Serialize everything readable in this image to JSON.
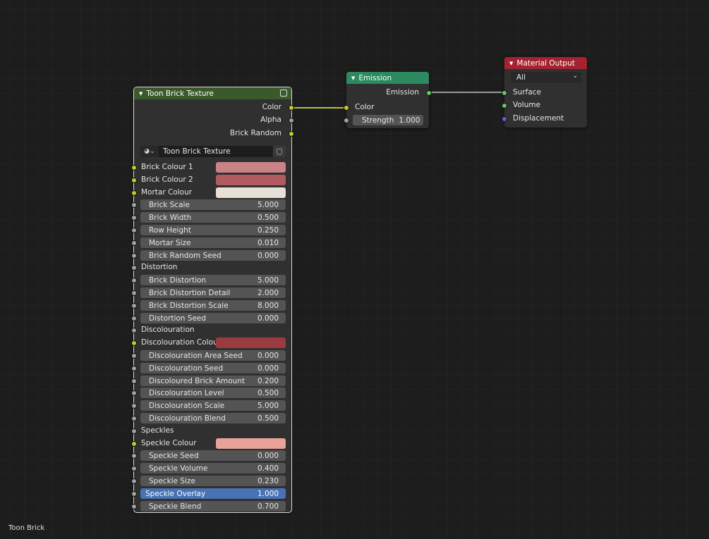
{
  "editor": {
    "material_name": "Toon Brick"
  },
  "colors": {
    "group_header": "#3b5a2c",
    "emission_header": "#2b8a5f",
    "output_header": "#a52330",
    "brick1": "#c98387",
    "brick2": "#b15b61",
    "mortar": "#e8e0d6",
    "discolouration": "#9b3b3f",
    "speckle": "#e8a29a"
  },
  "group_node": {
    "title": "Toon Brick Texture",
    "outputs": [
      "Color",
      "Alpha",
      "Brick Random"
    ],
    "datablock": "Toon Brick Texture",
    "inputs": [
      {
        "label": "Brick Colour 1",
        "type": "color",
        "color": "#c98387"
      },
      {
        "label": "Brick Colour 2",
        "type": "color",
        "color": "#b15b61"
      },
      {
        "label": "Mortar Colour",
        "type": "color",
        "color": "#e8e0d6"
      },
      {
        "label": "Brick Scale",
        "type": "value",
        "value": "5.000"
      },
      {
        "label": "Brick Width",
        "type": "value",
        "value": "0.500"
      },
      {
        "label": "Row Height",
        "type": "value",
        "value": "0.250"
      },
      {
        "label": "Mortar Size",
        "type": "value",
        "value": "0.010"
      },
      {
        "label": "Brick Random Seed",
        "type": "value",
        "value": "0.000"
      },
      {
        "label": "Distortion",
        "type": "label"
      },
      {
        "label": "Brick Distortion",
        "type": "value",
        "value": "5.000"
      },
      {
        "label": "Brick Distortion Detail",
        "type": "value",
        "value": "2.000"
      },
      {
        "label": "Brick Distortion Scale",
        "type": "value",
        "value": "8.000"
      },
      {
        "label": "Distortion Seed",
        "type": "value",
        "value": "0.000"
      },
      {
        "label": "Discolouration",
        "type": "label"
      },
      {
        "label": "Discolouration Colour",
        "type": "color",
        "color": "#9b3b3f"
      },
      {
        "label": "Discolouration Area Seed",
        "type": "value",
        "value": "0.000"
      },
      {
        "label": "Discolouration Seed",
        "type": "value",
        "value": "0.000"
      },
      {
        "label": "Discoloured Brick Amount",
        "type": "value",
        "value": "0.200"
      },
      {
        "label": "Discolouration Level",
        "type": "value",
        "value": "0.500"
      },
      {
        "label": "Discolouration Scale",
        "type": "value",
        "value": "5.000"
      },
      {
        "label": "Discolouration Blend",
        "type": "value",
        "value": "0.500"
      },
      {
        "label": "Speckles",
        "type": "label"
      },
      {
        "label": "Speckle Colour",
        "type": "color",
        "color": "#e8a29a"
      },
      {
        "label": "Speckle Seed",
        "type": "value",
        "value": "0.000"
      },
      {
        "label": "Speckle Volume",
        "type": "value",
        "value": "0.400"
      },
      {
        "label": "Speckle Size",
        "type": "value",
        "value": "0.230"
      },
      {
        "label": "Speckle Overlay",
        "type": "value",
        "value": "1.000",
        "active": true
      },
      {
        "label": "Speckle Blend",
        "type": "value",
        "value": "0.700"
      }
    ]
  },
  "emission_node": {
    "title": "Emission",
    "output": "Emission",
    "color_label": "Color",
    "strength_label": "Strength",
    "strength_value": "1.000"
  },
  "output_node": {
    "title": "Material Output",
    "target": "All",
    "inputs": [
      "Surface",
      "Volume",
      "Displacement"
    ]
  }
}
